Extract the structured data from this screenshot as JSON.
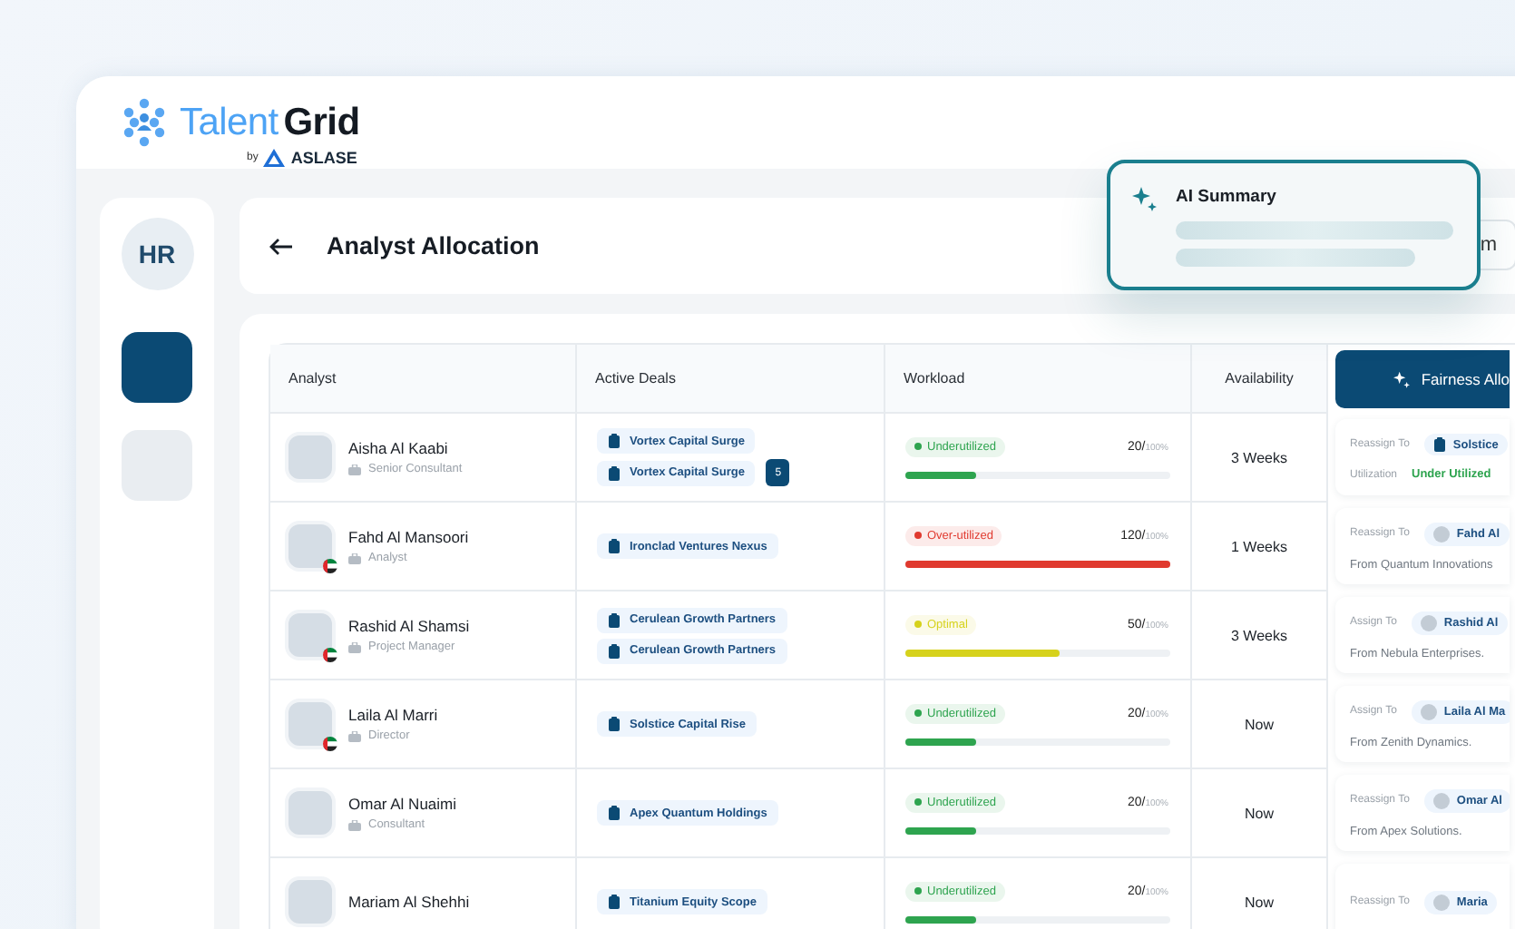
{
  "brand": {
    "name_part_1": "Talent",
    "name_part_2": "Grid",
    "by": "by",
    "company": "ASLASE"
  },
  "sidebar": {
    "user_initials": "HR",
    "nav_items": [
      {
        "selected": true
      },
      {
        "selected": false
      }
    ]
  },
  "header": {
    "title": "Analyst Allocation",
    "field_text": "m"
  },
  "ai_summary": {
    "title": "AI Summary"
  },
  "table": {
    "columns": [
      "Analyst",
      "Active Deals",
      "Workload",
      "Availability",
      "Fairness Allo"
    ],
    "rows": [
      {
        "name": "Aisha Al Kaabi",
        "role": "Senior Consultant",
        "flag": false,
        "deals": [
          "Vortex Capital Surge",
          "Vortex Capital Surge"
        ],
        "more_count": "5",
        "status": {
          "label": "Underutilized",
          "color": "#2ea44f"
        },
        "load": "20/",
        "max": "100%",
        "level": 0.27,
        "availability": "3 Weeks",
        "suggestion": {
          "kind": "utilization",
          "label": "Reassign To",
          "target": "Solstice",
          "detail_label": "Utilization",
          "detail": "Under Utilized"
        }
      },
      {
        "name": "Fahd Al Mansoori",
        "role": "Analyst",
        "flag": true,
        "deals": [
          "Ironclad Ventures Nexus"
        ],
        "status": {
          "label": "Over-utilized",
          "color": "#e03a2f"
        },
        "load": "120/",
        "max": "100%",
        "level": 1,
        "availability": "1 Weeks",
        "suggestion": {
          "kind": "source",
          "label": "Reassign To",
          "target": "Fahd Al",
          "detail": "From Quantum Innovations"
        }
      },
      {
        "name": "Rashid Al Shamsi",
        "role": "Project Manager",
        "flag": true,
        "deals": [
          "Cerulean Growth Partners",
          "Cerulean Growth Partners"
        ],
        "status": {
          "label": "Optimal",
          "color": "#d6d21c"
        },
        "load": "50/",
        "max": "100%",
        "level": 0.58,
        "availability": "3 Weeks",
        "suggestion": {
          "kind": "source",
          "label": "Assign To",
          "target": "Rashid Al",
          "detail": "From Nebula Enterprises."
        }
      },
      {
        "name": "Laila Al Marri",
        "role": "Director",
        "flag": true,
        "deals": [
          "Solstice Capital Rise"
        ],
        "status": {
          "label": "Underutilized",
          "color": "#2ea44f"
        },
        "load": "20/",
        "max": "100%",
        "level": 0.27,
        "availability": "Now",
        "suggestion": {
          "kind": "source",
          "label": "Assign To",
          "target": "Laila Al Ma",
          "detail": "From Zenith Dynamics."
        }
      },
      {
        "name": "Omar Al Nuaimi",
        "role": "Consultant",
        "flag": false,
        "deals": [
          "Apex Quantum Holdings"
        ],
        "status": {
          "label": "Underutilized",
          "color": "#2ea44f"
        },
        "load": "20/",
        "max": "100%",
        "level": 0.27,
        "availability": "Now",
        "suggestion": {
          "kind": "source",
          "label": "Reassign To",
          "target": "Omar Al",
          "detail": "From Apex Solutions."
        }
      },
      {
        "name": "Mariam Al Shehhi",
        "flag": false,
        "deals": [
          "Titanium Equity Scope"
        ],
        "status": {
          "label": "Underutilized",
          "color": "#2ea44f"
        },
        "load": "20/",
        "max": "100%",
        "level": 0.27,
        "availability": "Now",
        "suggestion": {
          "kind": "source",
          "label": "Reassign To",
          "target": "Maria"
        }
      }
    ]
  }
}
